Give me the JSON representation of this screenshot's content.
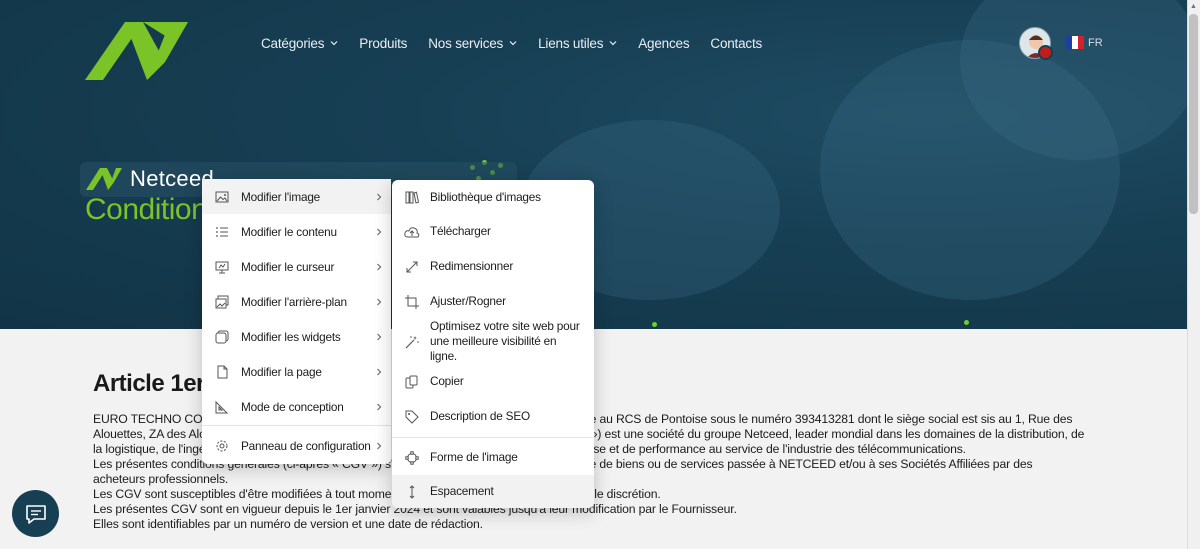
{
  "nav": {
    "items": [
      {
        "label": "Catégories",
        "has_dropdown": true
      },
      {
        "label": "Produits",
        "has_dropdown": false
      },
      {
        "label": "Nos services",
        "has_dropdown": true
      },
      {
        "label": "Liens utiles",
        "has_dropdown": true
      },
      {
        "label": "Agences",
        "has_dropdown": false
      },
      {
        "label": "Contacts",
        "has_dropdown": false
      }
    ]
  },
  "language": {
    "code": "FR",
    "flag_colors": [
      "#1f3fa0",
      "#ffffff",
      "#d6202a"
    ]
  },
  "hero": {
    "brand_name": "Netceed",
    "title": "Conditions"
  },
  "colors": {
    "hero_bg": "#173f54",
    "accent_green": "#7bc427",
    "menu_bg": "#ffffff"
  },
  "article": {
    "title": "Article 1er -",
    "lines": [
      {
        "left": "EURO TECHNO CO",
        "right": "scrite au RCS de Pontoise sous le numéro 393413281 dont le siège social est sis au 1, Rue des"
      },
      {
        "left": "Alouettes, ZA des Alo",
        "right": "ur ») est une société du groupe Netceed, leader mondial dans les domaines de la distribution, de"
      },
      {
        "left": "la logistique, de l'ingé",
        "right": "ertise et de performance au service de l'industrie des télécommunications."
      },
      {
        "left": "Les présentes conditions générales (ci-après « CGV ») s'a",
        "right": "ure de biens ou de services passée à NETCEED et/ou à ses Sociétés Affiliées par des"
      },
      {
        "left": "acheteurs professionnels.",
        "right": ""
      },
      {
        "left": "Les CGV sont susceptibles d'être modifiées à tout momen",
        "right": "eule discrétion."
      },
      {
        "left": "Les présentes CGV sont en vigueur depuis le 1er janvier 2024 et sont valables jusqu'à leur modification par le Fournisseur.",
        "right": ""
      },
      {
        "left": "Elles sont identifiables par un numéro de version et une date de rédaction.",
        "right": ""
      }
    ]
  },
  "context_menu": {
    "items": [
      {
        "label": "Modifier l'image",
        "icon": "image-icon",
        "active": true
      },
      {
        "label": "Modifier le contenu",
        "icon": "list-icon"
      },
      {
        "label": "Modifier le curseur",
        "icon": "presentation-icon"
      },
      {
        "label": "Modifier l'arrière-plan",
        "icon": "photo-stack-icon"
      },
      {
        "label": "Modifier les widgets",
        "icon": "widget-icon"
      },
      {
        "label": "Modifier la page",
        "icon": "page-icon"
      },
      {
        "label": "Mode de conception",
        "icon": "set-square-icon"
      },
      {
        "label": "Panneau de configuration",
        "icon": "gear-icon"
      }
    ]
  },
  "submenu": {
    "items": [
      {
        "label": "Bibliothèque d'images",
        "icon": "library-icon"
      },
      {
        "label": "Télécharger",
        "icon": "cloud-upload-icon"
      },
      {
        "label": "Redimensionner",
        "icon": "resize-icon"
      },
      {
        "label": "Ajuster/Rogner",
        "icon": "crop-icon"
      },
      {
        "label": "Optimisez votre site web pour une meilleure visibilité en ligne.",
        "icon": "magic-wand-icon"
      },
      {
        "label": "Copier",
        "icon": "copy-icon"
      },
      {
        "label": "Description de SEO",
        "icon": "tag-icon"
      },
      {
        "label": "Forme de l'image",
        "icon": "shape-icon"
      },
      {
        "label": "Espacement",
        "icon": "spacing-icon"
      }
    ]
  }
}
